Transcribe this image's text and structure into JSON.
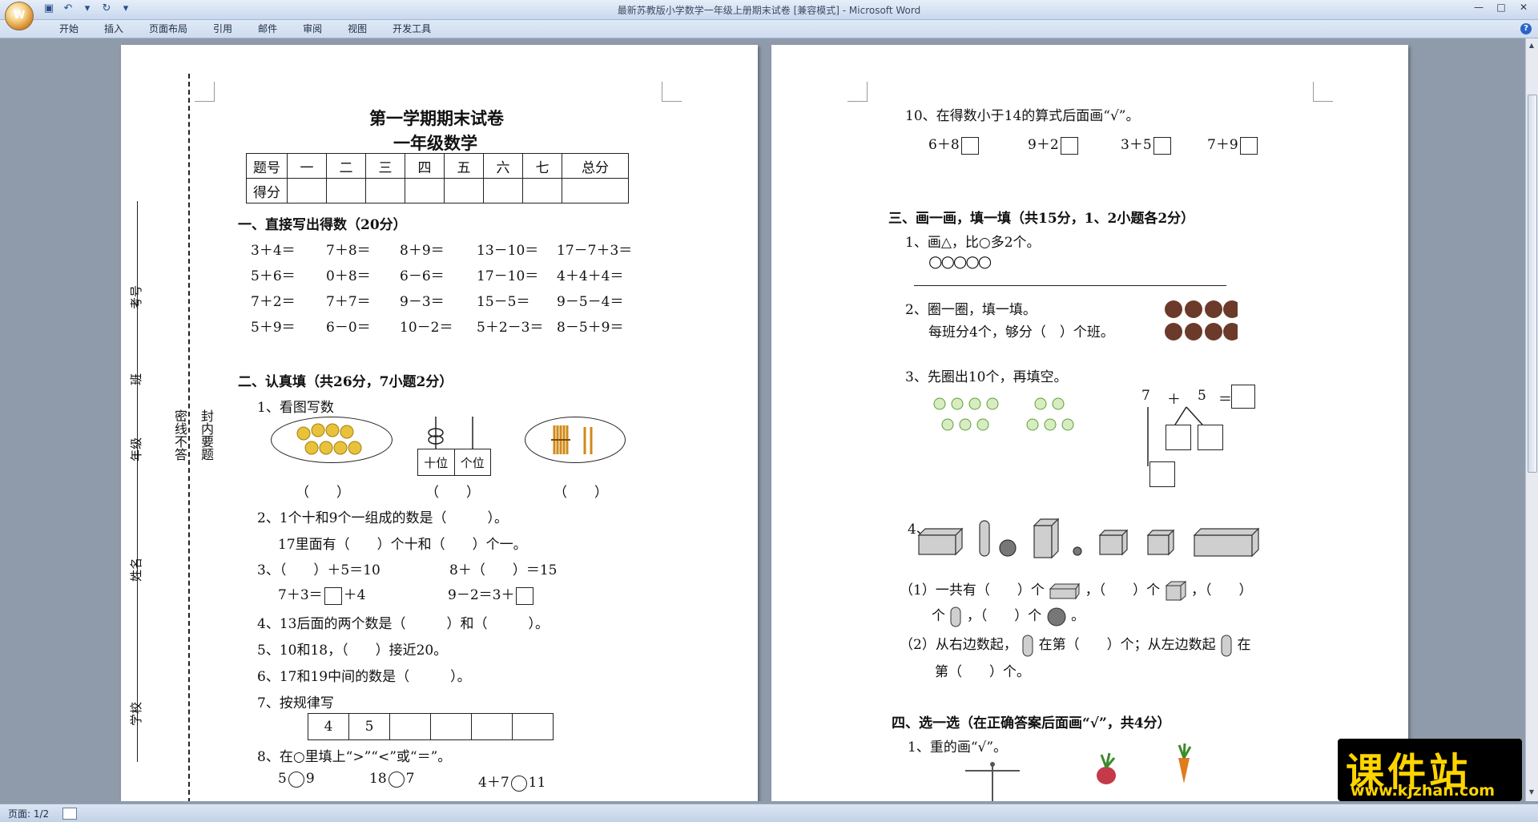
{
  "window": {
    "title": "最新苏教版小学数学一年级上册期末试卷 [兼容模式] - Microsoft Word",
    "tabs": [
      "开始",
      "插入",
      "页面布局",
      "引用",
      "邮件",
      "审阅",
      "视图",
      "开发工具"
    ]
  },
  "status": {
    "page": "页面: 1/2"
  },
  "watermark": {
    "brand": "课件站",
    "url": "www.kjzhan.com"
  },
  "page1": {
    "title": "第一学期期末试卷",
    "subtitle": "一年级数学",
    "score_table": {
      "row1": [
        "题号",
        "一",
        "二",
        "三",
        "四",
        "五",
        "六",
        "七",
        "总分"
      ],
      "row2_label": "得分"
    },
    "side": {
      "kaohao": "考号",
      "ban": "班",
      "nianji": "年级",
      "xingming": "姓名",
      "xuexiao": "学校"
    },
    "seal_left": "密线不答",
    "seal_right": "封内要题",
    "s1_title": "一、直接写出得数（20分）",
    "s1_rows": [
      [
        "3＋4＝",
        "7＋8＝",
        "8＋9＝",
        "13－10＝",
        "17－7＋3＝"
      ],
      [
        "5＋6＝",
        "0＋8＝",
        "6－6＝",
        "17－10＝",
        "4＋4＋4＝"
      ],
      [
        "7＋2＝",
        "7＋7＝",
        "9－3＝",
        "15－5＝",
        "9－5－4＝"
      ],
      [
        "5＋9＝",
        "6－0＝",
        "10－2＝",
        "5＋2－3＝",
        "8－5＋9＝"
      ]
    ],
    "s2_title": "二、认真填（共26分，7小题2分）",
    "q1": "1、看图写数",
    "abacus_labels": [
      "十位",
      "个位"
    ],
    "paren": "（　　）",
    "q2a": "2、1个十和9个一组成的数是（　　　）。",
    "q2b": "17里面有（　　）个十和（　　）个一。",
    "q3a1": "3、（　　）＋5＝10",
    "q3a2": "8＋（　　）＝15",
    "q3b1_pre": "7＋3＝",
    "q3b1_post": "＋4",
    "q3b2_pre": "9－2＝3＋",
    "q4": "4、13后面的两个数是（　　　）和（　　　）。",
    "q5": "5、10和18，（　　）接近20。",
    "q6": "6、17和19中间的数是（　　　）。",
    "q7": "7、按规律写",
    "q7_seq": [
      "4",
      "5",
      "",
      "",
      "",
      "",
      ""
    ],
    "q8": "8、在○里填上“>”“<”或“＝”。",
    "q8_items": [
      [
        "5",
        "9"
      ],
      [
        "18",
        "7"
      ],
      [
        "4＋7",
        "11"
      ]
    ]
  },
  "page2": {
    "q10": "10、在得数小于14的算式后面画“√”。",
    "q10_items": [
      "6＋8",
      "9＋2",
      "3＋5",
      "7＋9"
    ],
    "s3_title": "三、画一画，填一填（共15分，1、2小题各2分）",
    "s3q1": "1、画△，比○多2个。",
    "s3q1_circles": "○○○○○",
    "s3q2a": "2、圈一圈，填一填。",
    "s3q2b": "每班分4个，够分（　）个班。",
    "s3q3": "3、先圈出10个，再填空。",
    "eq": [
      "7",
      "＋",
      "5",
      "＝"
    ],
    "s3q4": "4、",
    "s3q4_1a": "（1）一共有（　　）个",
    "s3q4_1b": "，（　　）个",
    "s3q4_1c": "，（　　）",
    "s3q4_1d": "个",
    "s3q4_1e": "，（　　）个",
    "s3q4_1f": "。",
    "s3q4_2a": "（2）从右边数起，",
    "s3q4_2b": "在第（　　）个；从左边数起",
    "s3q4_2c": "在",
    "s3q4_2d": "第（　　）个。",
    "s4_title": "四、选一选（在正确答案后面画“√”，共4分）",
    "s4q1": "1、重的画“√”。"
  }
}
